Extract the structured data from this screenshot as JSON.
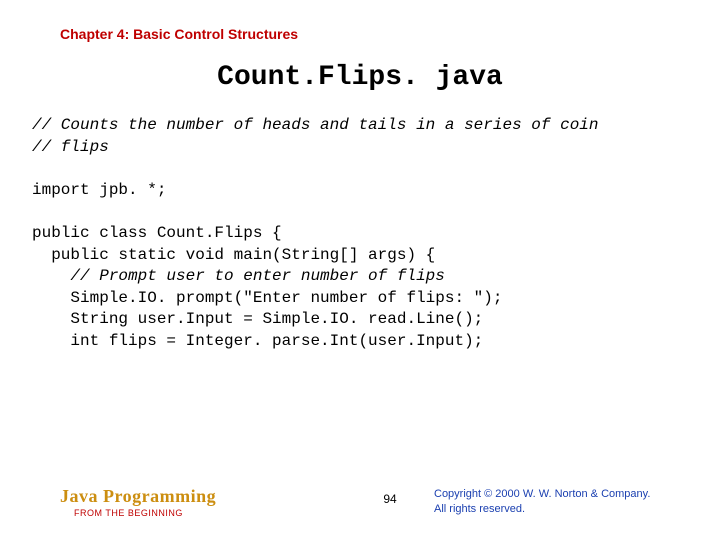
{
  "header": {
    "chapter": "Chapter 4: Basic Control Structures"
  },
  "title": "Count.Flips. java",
  "code": {
    "l1": "// Counts the number of heads and tails in a series of coin",
    "l2": "// flips",
    "l3": "",
    "l4": "import jpb. *;",
    "l5": "",
    "l6": "public class Count.Flips {",
    "l7": "  public static void main(String[] args) {",
    "l8_a": "    ",
    "l8_b": "// Prompt user to enter number of flips",
    "l9": "    Simple.IO. prompt(\"Enter number of flips: \");",
    "l10": "    String user.Input = Simple.IO. read.Line();",
    "l11": "    int flips = Integer. parse.Int(user.Input);"
  },
  "footer": {
    "book_title": "Java Programming",
    "book_sub": "FROM THE BEGINNING",
    "page_num": "94",
    "copyright_l1": "Copyright © 2000 W. W. Norton & Company.",
    "copyright_l2": "All rights reserved."
  }
}
